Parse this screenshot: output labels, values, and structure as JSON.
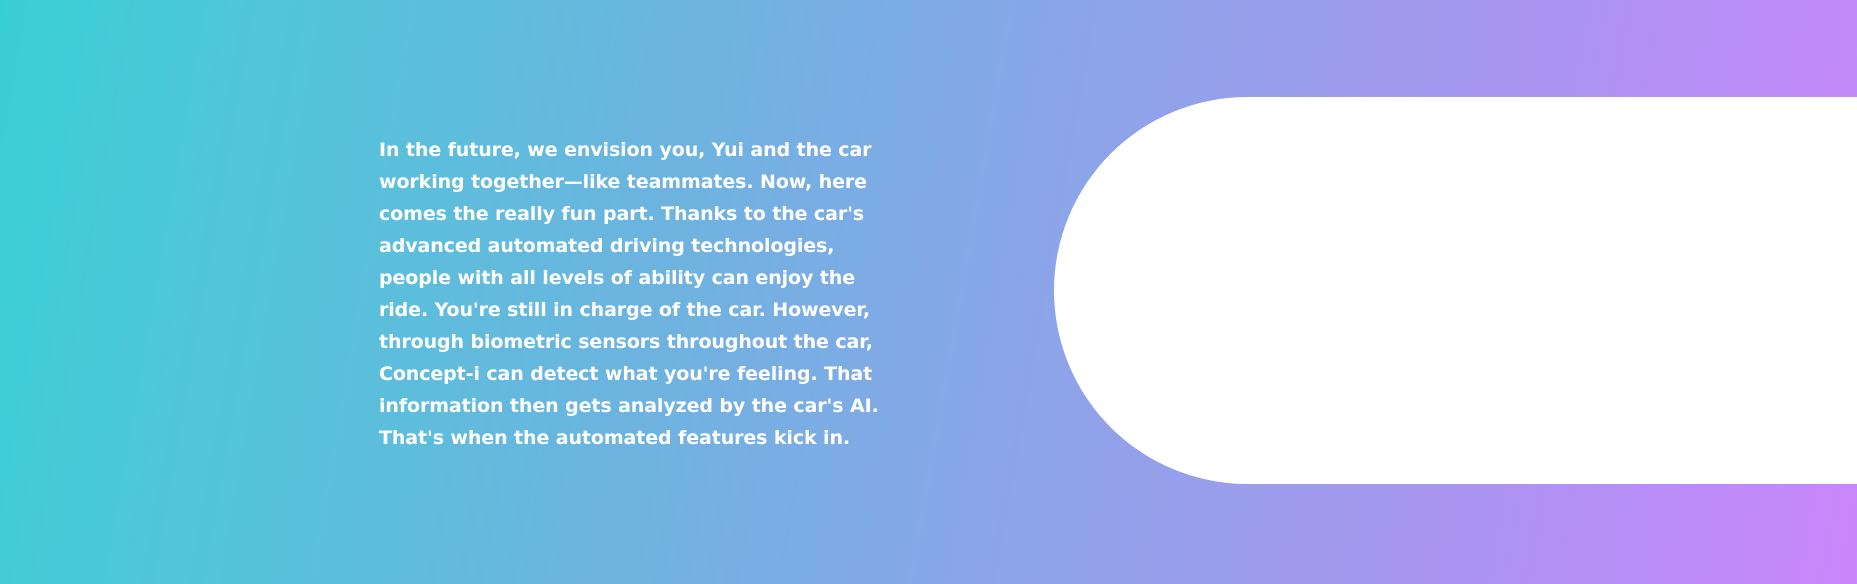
{
  "hero": {
    "text": "In the future, we envision you, Yui and the car working together—like teammates. Now, here comes the really fun part. Thanks to the car's advanced automated driving technologies, people with all levels of ability can enjoy the ride. You're still in charge of the car. However, through biometric sensors throughout the car, Concept-i can detect what you're feeling. That information then gets analyzed by the car's AI. That's when the automated features kick in."
  },
  "colors": {
    "gradient_start": "#38cfd4",
    "gradient_end": "#ca86fb",
    "text": "#ffffff",
    "pill": "#ffffff"
  }
}
